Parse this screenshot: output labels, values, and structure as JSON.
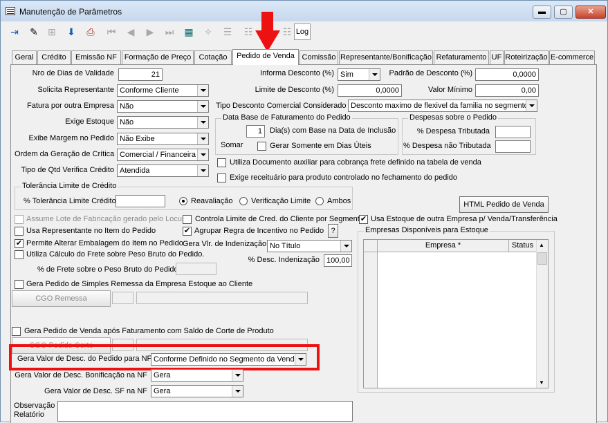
{
  "window": {
    "title": "Manutenção de Parâmetros",
    "btn_min": "▬",
    "btn_max": "▢",
    "btn_close": "✕"
  },
  "toolbar": {
    "log_label": "Log"
  },
  "tabs": [
    "Geral",
    "Crédito",
    "Emissão NF",
    "Formação de Preço",
    "Cotação",
    "Pedido de Venda",
    "Comissão",
    "Representante/Bonificação",
    "Refaturamento",
    "UF",
    "Roteirização",
    "E-commerce"
  ],
  "form": {
    "nro_dias_validade": {
      "label": "Nro de Dias de Validade",
      "value": "21"
    },
    "solicita_representante": {
      "label": "Solicita Representante",
      "value": "Conforme Cliente"
    },
    "fatura_outra_empresa": {
      "label": "Fatura por outra Empresa",
      "value": "Não"
    },
    "exige_estoque": {
      "label": "Exige Estoque",
      "value": "Não"
    },
    "exibe_margem": {
      "label": "Exibe Margem no Pedido",
      "value": "Não Exibe"
    },
    "ordem_geracao_critica": {
      "label": "Ordem da Geração de Crítica",
      "value": "Comercial / Financeira"
    },
    "tipo_qtd_verifica_credito": {
      "label": "Tipo de Qtd Verifica Crédito",
      "value": "Atendida"
    },
    "informa_desconto": {
      "label": "Informa Desconto (%)",
      "value": "Sim"
    },
    "padrao_desconto": {
      "label": "Padrão de Desconto (%)",
      "value": "0,0000"
    },
    "limite_desconto": {
      "label": "Limite de Desconto (%)",
      "value": "0,0000"
    },
    "valor_minimo": {
      "label": "Valor Mínimo",
      "value": "0,00"
    },
    "tipo_desconto_comercial": {
      "label": "Tipo Desconto Comercial Considerado",
      "value": "Desconto maximo de flexivel da familia no segmento"
    },
    "data_base_group": {
      "caption": "Data Base de Faturamento do Pedido",
      "dias_value": "1",
      "dias_label": "Dia(s)  com Base na Data de Inclusão",
      "somar_label": "Somar",
      "gerar_dias_uteis_label": "Gerar Somente em Dias Úteis"
    },
    "despesas_group": {
      "caption": "Despesas sobre o Pedido",
      "tributada_label": "% Despesa Tributada",
      "nao_tributada_label": "% Despesa não Tributada"
    },
    "utiliza_documento_auxiliar": "Utiliza Documento auxiliar para cobrança frete definido na tabela de venda",
    "exige_receituario": "Exige receituário para produto controlado no fechamento do pedido",
    "tolerancia_group": {
      "caption": "Tolerância Limite de Crédito",
      "label": "% Tolerância Limite Crédito",
      "opt_reavaliacao": "Reavaliação",
      "opt_verificacao": "Verificação Limite",
      "opt_ambos": "Ambos"
    },
    "html_pedido_button": "HTML Pedido de Venda",
    "assume_lote": "Assume Lote de Fabricação gerado pelo Locus",
    "usa_representante_item": "Usa Representante no Item do Pedido",
    "permite_alterar_embalagem": "Permite Alterar Embalagem do Item no Pedido",
    "utiliza_calculo_frete": "Utiliza Cálculo do Frete sobre Peso Bruto do Pedido.",
    "perc_frete_label": "% de Frete sobre o Peso Bruto do Pedido",
    "gera_pedido_simples_remessa": "Gera Pedido de Simples Remessa da Empresa Estoque ao Cliente",
    "cgo_remessa_button": "CGO Remessa",
    "controla_limite_credito": "Controla Limite de Cred. do Cliente por Segmento",
    "usa_estoque_outra_empresa": "Usa Estoque de outra Empresa p/ Venda/Transferência",
    "agrupar_regra_incentivo": "Agrupar Regra de Incentivo no Pedido",
    "help_button": "?",
    "gera_vlr_indenizacao": {
      "label": "Gera Vlr. de Indenização",
      "value": "No Título"
    },
    "desc_indenizacao": {
      "label": "% Desc. Indenização",
      "value": "100,00"
    },
    "empresas_group": {
      "caption": "Empresas Disponíveis para Estoque",
      "col_empresa": "Empresa *",
      "col_status": "Status"
    },
    "gera_pedido_apos_faturamento": "Gera Pedido de Venda após Faturamento com Saldo de Corte de Produto",
    "cgo_pedido_corte_button": "CGO Pedido Corte",
    "gera_valor_desc_pedido": {
      "label": "Gera Valor de Desc. do Pedido para NF",
      "value": "Conforme Definido no Segmento da Venda"
    },
    "gera_valor_desc_bonificacao": {
      "label": "Gera Valor de Desc. Bonificação na NF",
      "value": "Gera"
    },
    "gera_valor_desc_sf": {
      "label": "Gera Valor de Desc. SF na NF",
      "value": "Gera"
    },
    "observacao_label": "Observação Relatório"
  },
  "colors": {
    "highlight": "#ee1111"
  }
}
